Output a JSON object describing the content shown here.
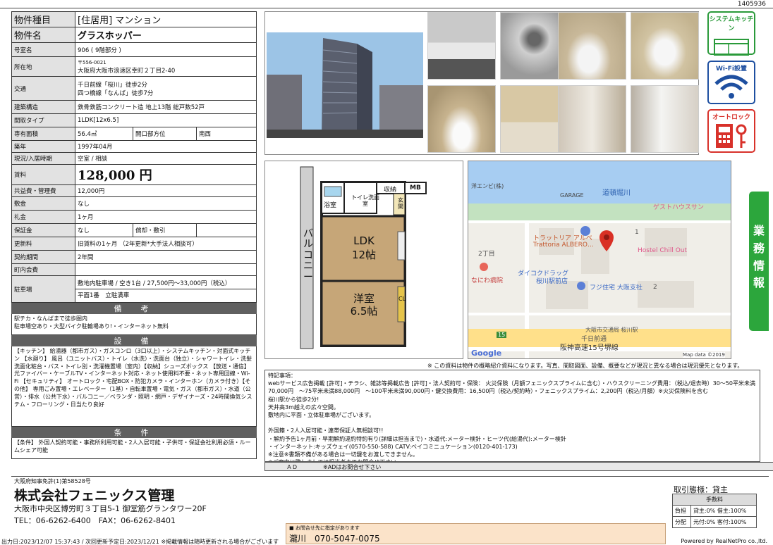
{
  "doc_id": "1405936",
  "property": {
    "type_label": "物件種目",
    "type_value": "[住居用] マンション",
    "name_label": "物件名",
    "name_value": "グラスホッパー",
    "room_label": "号室名",
    "room_value": "906 ( 9階部分 )",
    "address_label": "所在地",
    "zip": "〒556-0021",
    "address_value": "大阪府大阪市浪速区幸町２丁目2-40",
    "access_label": "交通",
    "access_1": "千日前線「桜川」徒歩2分",
    "access_2": "四つ橋線「なんば」徒歩7分",
    "structure_label": "建築構造",
    "structure_value": "鉄骨鉄筋コンクリート造 地上13階 総戸数52戸",
    "layout_label": "間取タイプ",
    "layout_value": "1LDK[12x6.5]",
    "area_label": "専有面積",
    "area_value": "56.4㎡",
    "direction_label": "開口部方位",
    "direction_value": "南西",
    "built_label": "築年",
    "built_value": "1997年04月",
    "status_label": "現況/入居時期",
    "status_value": "空室 / 相談",
    "rent_label": "賃料",
    "rent_value": "128,000 円",
    "fee_label": "共益費・管理費",
    "fee_value": "12,000円",
    "deposit_label": "敷金",
    "deposit_value": "なし",
    "key_label": "礼金",
    "key_value": "1ヶ月",
    "guarantee_label": "保証金",
    "guarantee_value": "なし",
    "amort_label": "償却・敷引",
    "amort_value": "",
    "renew_label": "更新料",
    "renew_value": "旧賃料の1ヶ月 （2年更新*大手法人相談可）",
    "contract_label": "契約期間",
    "contract_value": "2年間",
    "town_label": "町内会費",
    "town_value": "",
    "parking_label": "駐車場",
    "parking_1": "敷地内駐車場 / 空き1台 / 27,500円～33,000円（税込）",
    "parking_2": "平面1番　立駐満車"
  },
  "remarks_h": "備　考",
  "remarks_text": "駅チカ・なんばまで徒歩圏内\n駐車場空あり・大型バイク駐輪場あり!・インターネット無料",
  "equip_h": "設　備",
  "equip_text": "【キッチン】 給湯器（都市ガス）・ガスコンロ（3口以上）・システムキッチン・対面式キッチン 【水廻り】 風呂（ユニットバス）・トイレ（水洗）・洗面台（独立）・シャワートイレ・洗髪洗面化粧台・バス・トイレ別・洗濯機置場（室内）【収納】シューズボックス 【放送・通信】光ファイバー・ケーブルTV・インターネット対応・ネット使用料不要・ネット専用回線・Wi-Fi 【セキュリティ】 オートロック・宅配BOX・防犯カメラ・インターホン（カメラ付き）【その他】 専用ごみ置場・エレベーター（1基）・自転車置場・電気・ガス（都市ガス）・水道（公営）・排水（公共下水）・バルコニー／ベランダ・照明・網戸・デザイナーズ・24時間換気システム・フローリング・日当たり良好",
  "cond_h": "条　件",
  "cond_text": "【条件】 外国人契約可能・事務所利用可能・2人入居可能・子供可・保証会社利用必須・ルームシェア可能",
  "badges": {
    "kitchen": "システムキッチン",
    "wifi": "Wi-Fi設置",
    "lock": "オートロック"
  },
  "floorplan": {
    "bath": "浴室",
    "toilet": "トイレ洗面室",
    "storage": "収納",
    "mb": "MB",
    "entrance": "玄関",
    "balcony": "バルコニー",
    "ldk": "LDK",
    "ldk_size": "12帖",
    "room": "洋室",
    "room_size": "6.5帖",
    "cl": "CL"
  },
  "map": {
    "river": "道頓堀川",
    "garage": "GARAGE",
    "guesthouse": "ゲストハウスサン",
    "trattoria": "トラットリア アルベ",
    "trattoria2": "Trattoria ALBERO…",
    "hotel": "Hostel Chill Out",
    "drug": "ダイコクドラッグ",
    "drug2": "桜川駅前店",
    "fuji": "フジ住宅 大阪支社",
    "hospital": "なにわ病院",
    "chome2": "2丁目",
    "road": "阪神高速15号堺線",
    "sennichi": "千日前通",
    "station": "大阪市交通局 桜川駅",
    "yan": "洋エンビ(株)",
    "google": "Google",
    "credit": "Map data ©2019",
    "n1": "1",
    "n2": "2",
    "n15": "15"
  },
  "disclaimer": "※ この資料は物件の概略紹介資料になります。写真、間取図面、設備、概要などが現況と異なる場合は現況優先となります。",
  "notes": "特記事項：\nwebサービス広告掲載 [許可]・チラシ、雑誌等掲載広告 [許可]・法人契約可・保険： 火災保険（月額フェニックスプライムに含む）・ハウスクリーニング費用：（税込/退去時）30～50平米未満70,000円　～75平米未満88,000円　～100平米未満90,000円・鍵交換費用：16,500円（税込/契約時）・フェニックスプライム：2,200円（税込/月額）※火災保険料を含む\n桜川駅から徒歩2分!\n天井高3m越えの広々空間。\n敷地内に平面・立体駐車場がございます。\n\n外国籍・2人入居可能・連帯保証人無相談可!!\n・解約予告1ヶ月前・早期解約違約特約有り(詳細は担当まで)・水道代:メーター検針・ヒーツ代(給湯代):メーター検針\n・インターネット:キッズウェイ(0570-550-588) CATV:ベイコミニュケーション(0120-401-173)\n※注意※書類不備がある場合は一切鍵をお渡しできません。\n※ご案内に際しましては担当者までお問合せ下さい。",
  "ad_label": "ＡＤ",
  "ad_value": "※ADはお問合せ下さい",
  "sidetab": "業務情報",
  "company": {
    "license": "大阪府知事免許(1)第58528号",
    "name": "株式会社フェニックス管理",
    "address": "大阪市中央区博労町３丁目5-1 御堂筋グランタワー20F",
    "tel": "TEL：06-6262-6400　FAX：06-6262-8401"
  },
  "transaction": {
    "label": "取引態様：貸主",
    "fee_h": "手数料",
    "row1_l": "負担",
    "row1_v": "貸主:0% 借主:100%",
    "row2_l": "分配",
    "row2_v": "元付:0% 客付:100%"
  },
  "contact": {
    "note": "■ お問合せ先に指定があります",
    "name": "瀧川　070-5047-0075"
  },
  "footer": {
    "left": "出力日:2023/12/07 15:37:43 / 次回更新予定日:2023/12/21 ※掲載情報は随時更新される場合がございます",
    "right": "Powered by RealNetPro co.,ltd."
  }
}
